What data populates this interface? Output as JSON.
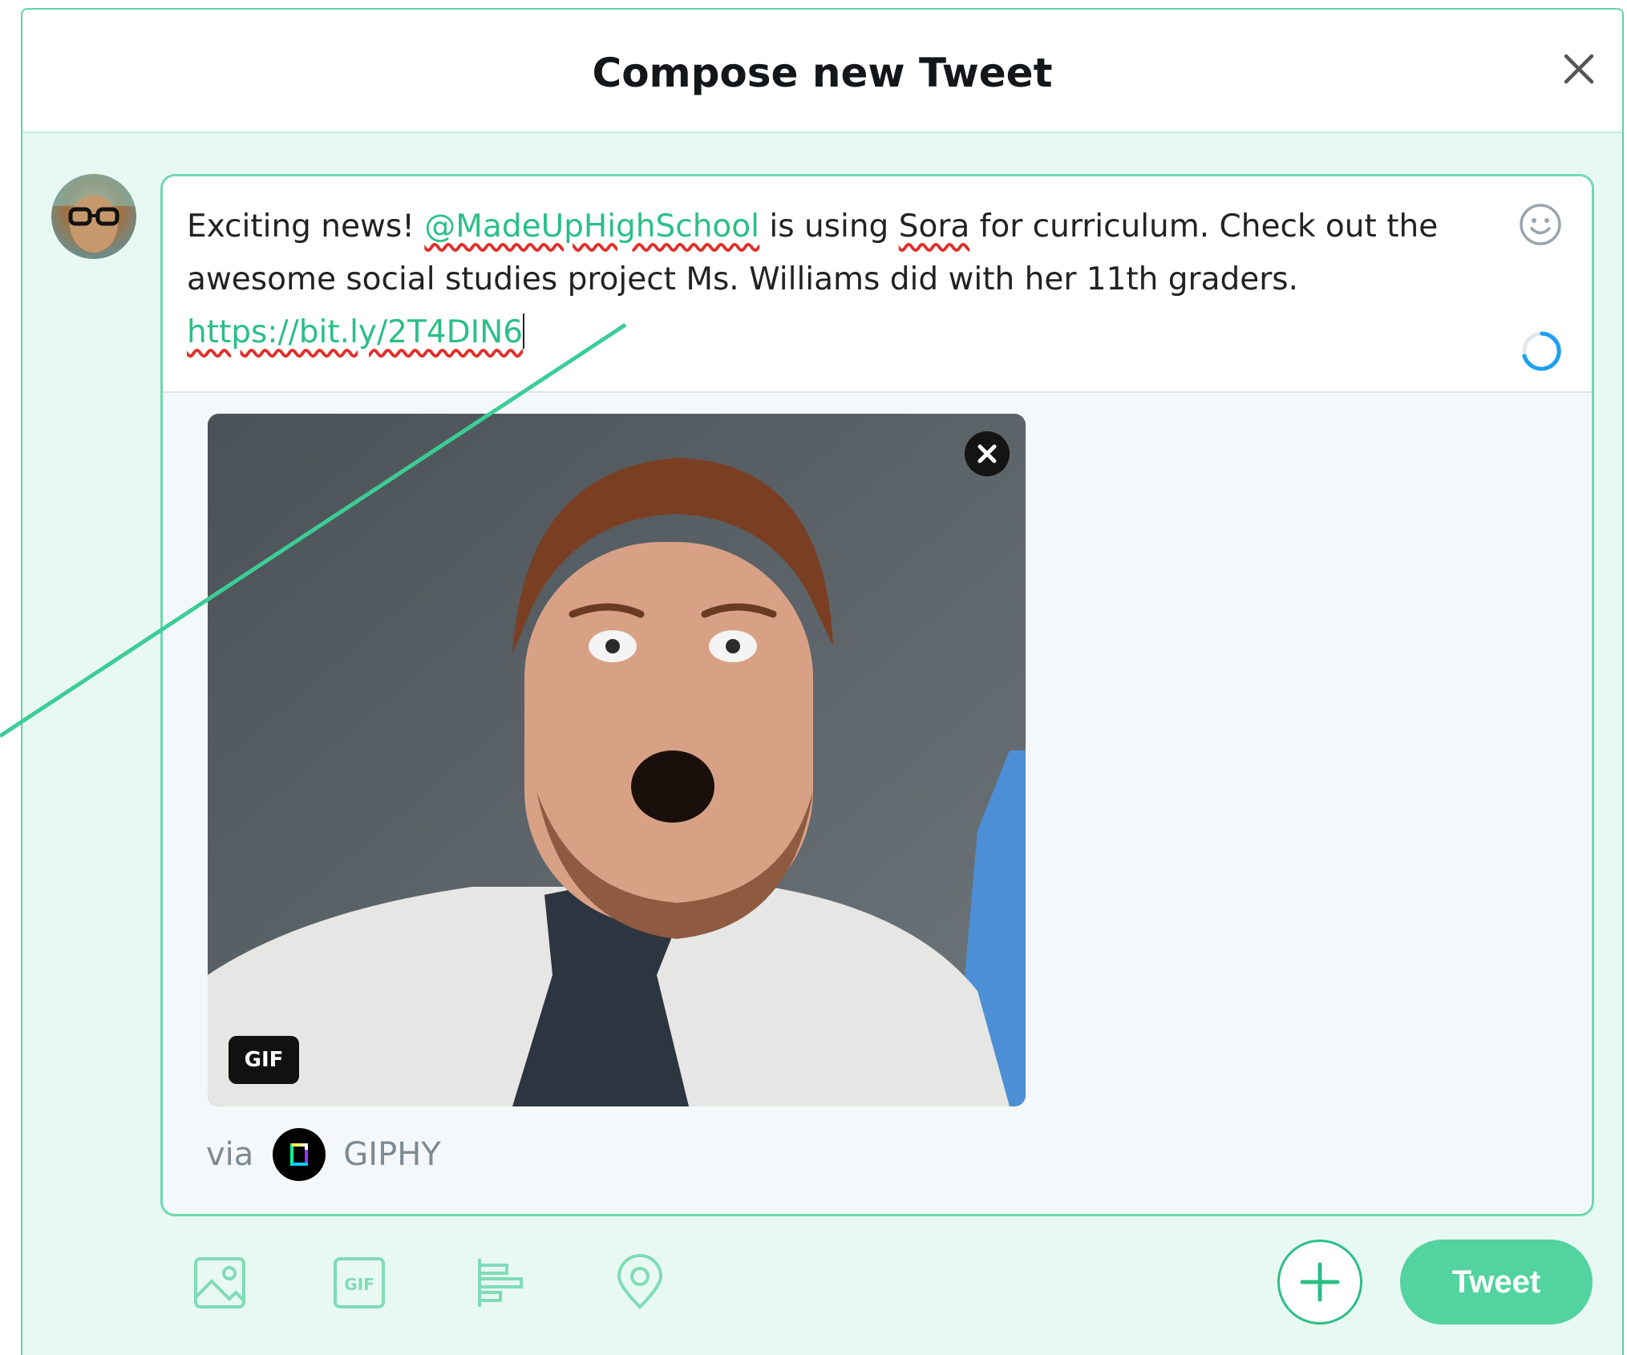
{
  "header": {
    "title": "Compose new Tweet"
  },
  "composer": {
    "text_before": "Exciting news! ",
    "mention": "@MadeUpHighSchool",
    "text_mid1": " is using ",
    "spell_word": "Sora",
    "text_mid2": " for curriculum. Check out the awesome social studies project Ms. Williams did with her 11th graders.",
    "link": "https://bit.ly/2T4DIN6"
  },
  "media": {
    "badge": "GIF",
    "attribution_via": "via",
    "attribution_source": "GIPHY"
  },
  "toolbar": {
    "tweet_label": "Tweet",
    "icons": [
      "image-icon",
      "gif-icon",
      "poll-icon",
      "location-icon"
    ]
  },
  "colors": {
    "accent": "#2bbf86",
    "button": "#52d3a0",
    "border": "#6fd8b1",
    "background": "#e8f8f2"
  }
}
